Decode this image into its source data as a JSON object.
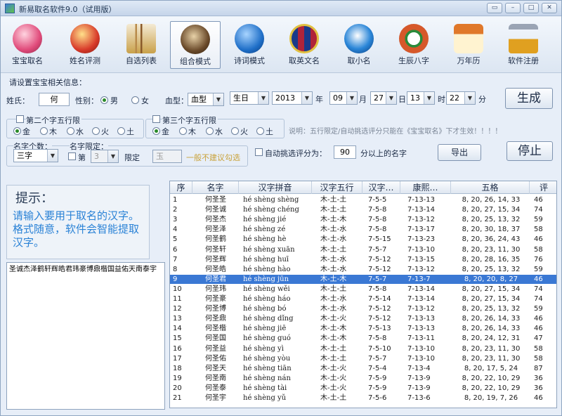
{
  "window": {
    "title": "新易取名软件9.0（试用版）",
    "controls": [
      "▭",
      "–",
      "□",
      "✕"
    ]
  },
  "toolbar": {
    "items": [
      {
        "label": "宝宝取名",
        "icon": "baby-icon",
        "color": "#e04a7a"
      },
      {
        "label": "姓名评测",
        "icon": "fortune-god-icon",
        "color": "#d83a2a"
      },
      {
        "label": "自选列表",
        "icon": "brush-pot-icon",
        "color": "#c9a14a"
      },
      {
        "label": "组合模式",
        "icon": "eagle-icon",
        "color": "#6a4a2a"
      },
      {
        "label": "诗词模式",
        "icon": "book-icon",
        "color": "#1f6fc8"
      },
      {
        "label": "取英文名",
        "icon": "barcelona-icon",
        "color": "#b0243a"
      },
      {
        "label": "取小名",
        "icon": "bird-icon",
        "color": "#2a86d8"
      },
      {
        "label": "生辰八字",
        "icon": "bagua-icon",
        "color": "#d6582a"
      },
      {
        "label": "万年历",
        "icon": "calendar-icon",
        "color": "#e0782a"
      },
      {
        "label": "软件注册",
        "icon": "lock-icon",
        "color": "#e0a020"
      }
    ]
  },
  "form": {
    "section_title": "请设置宝宝相关信息：",
    "surname_label": "姓氏：",
    "surname_value": "何",
    "gender_label": "性别：",
    "gender_male": "男",
    "gender_female": "女",
    "blood_label": "血型：",
    "blood_value": "血型",
    "birthday_value": "生日",
    "year_value": "2013",
    "year_unit": "年",
    "month_value": "09",
    "month_unit": "月",
    "day_value": "27",
    "day_unit": "日",
    "hour_value": "13",
    "hour_unit": "时",
    "minute_value": "22",
    "minute_unit": "分",
    "generate_label": "生成",
    "second_wuxing_label": "第二个字五行限",
    "third_wuxing_label": "第三个字五行限",
    "elements": [
      "金",
      "木",
      "水",
      "火",
      "土"
    ],
    "note": "说明：五行限定/自动挑选评分只能在《宝宝取名》下才生效！！！！",
    "name_length_label": "名字个数：",
    "name_length_value": "三字",
    "limit_label": "名字限定：",
    "limit_first": "第",
    "limit_index": "3",
    "limit_suffix": "限定",
    "limit_char_placeholder": "玉",
    "limit_warning": "一般不建议勾选",
    "auto_score_label": "自动挑选评分为：",
    "auto_score_value": "90",
    "auto_score_suffix": "分以上的名字",
    "export_label": "导出",
    "stop_label": "停止"
  },
  "tip": {
    "title": "提示：",
    "body": "请输入要用于取名的汉字。格式随意，软件会智能提取汉字。"
  },
  "chars_input": "圣诚杰泽鹤轩辉皓君玮豪博鼎楷国益佑天南泰宇",
  "table": {
    "headers": [
      "序",
      "名字",
      "汉字拼音",
      "汉字五行",
      "汉字…",
      "康熙…",
      "五格",
      "评"
    ],
    "selected_index": 8,
    "rows": [
      [
        "1",
        "何圣圣",
        "hé shèng shèng",
        "木-土-土",
        "7-5-5",
        "7-13-13",
        "8, 20, 26, 14, 33",
        "46"
      ],
      [
        "2",
        "何圣诚",
        "hé shèng chéng",
        "木-土-土",
        "7-5-8",
        "7-13-14",
        "8, 20, 27, 15, 34",
        "74"
      ],
      [
        "3",
        "何圣杰",
        "hé shèng jié",
        "木-土-木",
        "7-5-8",
        "7-13-12",
        "8, 20, 25, 13, 32",
        "59"
      ],
      [
        "4",
        "何圣泽",
        "hé shèng zé",
        "木-土-水",
        "7-5-8",
        "7-13-17",
        "8, 20, 30, 18, 37",
        "58"
      ],
      [
        "5",
        "何圣鹤",
        "hé shèng hè",
        "木-土-水",
        "7-5-15",
        "7-13-23",
        "8, 20, 36, 24, 43",
        "46"
      ],
      [
        "6",
        "何圣轩",
        "hé shèng xuān",
        "木-土-土",
        "7-5-7",
        "7-13-10",
        "8, 20, 23, 11, 30",
        "58"
      ],
      [
        "7",
        "何圣辉",
        "hé shèng huī",
        "木-土-水",
        "7-5-12",
        "7-13-15",
        "8, 20, 28, 16, 35",
        "76"
      ],
      [
        "8",
        "何圣皓",
        "hé shèng hào",
        "木-土-水",
        "7-5-12",
        "7-13-12",
        "8, 20, 25, 13, 32",
        "59"
      ],
      [
        "9",
        "何圣君",
        "hé shèng jūn",
        "木-土-木",
        "7-5-7",
        "7-13-7",
        "8, 20, 20, 8, 27",
        "46"
      ],
      [
        "10",
        "何圣玮",
        "hé shèng wěi",
        "木-土-土",
        "7-5-8",
        "7-13-14",
        "8, 20, 27, 15, 34",
        "74"
      ],
      [
        "11",
        "何圣豪",
        "hé shèng háo",
        "木-土-水",
        "7-5-14",
        "7-13-14",
        "8, 20, 27, 15, 34",
        "74"
      ],
      [
        "12",
        "何圣博",
        "hé shèng bó",
        "木-土-水",
        "7-5-12",
        "7-13-12",
        "8, 20, 25, 13, 32",
        "59"
      ],
      [
        "13",
        "何圣鼎",
        "hé shèng dǐng",
        "木-土-火",
        "7-5-12",
        "7-13-13",
        "8, 20, 26, 14, 33",
        "46"
      ],
      [
        "14",
        "何圣楷",
        "hé shèng jiē",
        "木-土-木",
        "7-5-13",
        "7-13-13",
        "8, 20, 26, 14, 33",
        "46"
      ],
      [
        "15",
        "何圣国",
        "hé shèng guó",
        "木-土-木",
        "7-5-8",
        "7-13-11",
        "8, 20, 24, 12, 31",
        "47"
      ],
      [
        "16",
        "何圣益",
        "hé shèng yì",
        "木-土-土",
        "7-5-10",
        "7-13-10",
        "8, 20, 23, 11, 30",
        "58"
      ],
      [
        "17",
        "何圣佑",
        "hé shèng yòu",
        "木-土-土",
        "7-5-7",
        "7-13-10",
        "8, 20, 23, 11, 30",
        "58"
      ],
      [
        "18",
        "何圣天",
        "hé shèng tiān",
        "木-土-火",
        "7-5-4",
        "7-13-4",
        "8, 20, 17, 5, 24",
        "87"
      ],
      [
        "19",
        "何圣南",
        "hé shèng nán",
        "木-土-火",
        "7-5-9",
        "7-13-9",
        "8, 20, 22, 10, 29",
        "36"
      ],
      [
        "20",
        "何圣泰",
        "hé shèng tài",
        "木-土-火",
        "7-5-9",
        "7-13-9",
        "8, 20, 22, 10, 29",
        "36"
      ],
      [
        "21",
        "何圣宇",
        "hé shèng yǔ",
        "木-土-土",
        "7-5-6",
        "7-13-6",
        "8, 20, 19, 7, 26",
        "46"
      ]
    ]
  },
  "colors": {
    "accent": "#3a78d4",
    "tip_text": "#2a82d6",
    "warning": "#c9a23a"
  }
}
